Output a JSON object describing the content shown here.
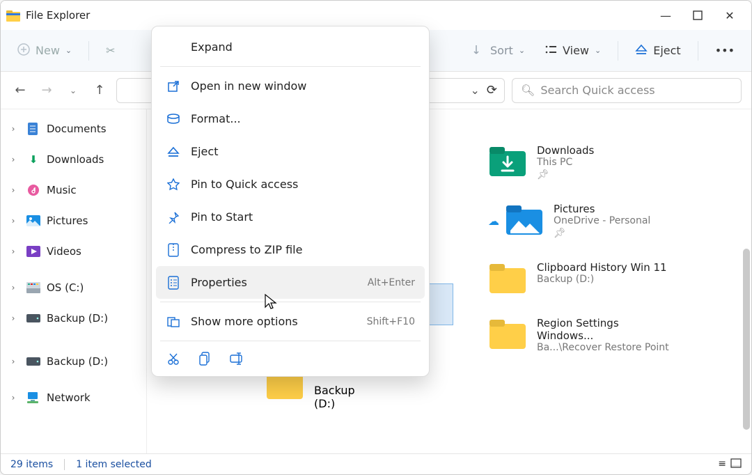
{
  "app": {
    "title": "File Explorer"
  },
  "win_controls": {
    "min": "—",
    "max": "▢",
    "close": "✕"
  },
  "toolbar": {
    "new_label": "New",
    "sort_label": "Sort",
    "view_label": "View",
    "eject_label": "Eject",
    "more_label": "•••"
  },
  "search": {
    "placeholder": "Search Quick access"
  },
  "nav": {
    "items": [
      {
        "label": "Documents",
        "icon": "documents"
      },
      {
        "label": "Downloads",
        "icon": "downloads-green"
      },
      {
        "label": "Music",
        "icon": "music"
      },
      {
        "label": "Pictures",
        "icon": "pictures"
      },
      {
        "label": "Videos",
        "icon": "videos"
      },
      {
        "label": "OS (C:)",
        "icon": "disk"
      },
      {
        "label": "Backup (D:)",
        "icon": "drive"
      },
      {
        "label": "Backup (D:)",
        "icon": "drive"
      },
      {
        "label": "Network",
        "icon": "network"
      }
    ]
  },
  "grid": {
    "items": [
      {
        "label": "Downloads",
        "sub": "This PC",
        "pinned": true,
        "icon": "downloads-teal",
        "cloud": false
      },
      {
        "label": "Pictures",
        "sub": "OneDrive - Personal",
        "pinned": true,
        "icon": "pictures-blue",
        "cloud": true
      },
      {
        "label": "Clipboard History Win 11",
        "sub": "Backup (D:)",
        "pinned": false,
        "icon": "folder",
        "cloud": false
      },
      {
        "label": "Region Settings Windows...",
        "sub": "Ba...\\Recover Restore Point",
        "pinned": false,
        "icon": "folder",
        "cloud": false
      },
      {
        "label": "",
        "sub": "Backup (D:)",
        "pinned": false,
        "icon": "folder",
        "cloud": false
      }
    ]
  },
  "context_menu": {
    "header": "Expand",
    "items": [
      {
        "label": "Open in new window",
        "icon": "open-window",
        "shortcut": ""
      },
      {
        "label": "Format...",
        "icon": "format",
        "shortcut": ""
      },
      {
        "label": "Eject",
        "icon": "eject",
        "shortcut": ""
      },
      {
        "label": "Pin to Quick access",
        "icon": "star",
        "shortcut": ""
      },
      {
        "label": "Pin to Start",
        "icon": "pin",
        "shortcut": ""
      },
      {
        "label": "Compress to ZIP file",
        "icon": "zip",
        "shortcut": ""
      },
      {
        "label": "Properties",
        "icon": "properties",
        "shortcut": "Alt+Enter",
        "hover": true
      },
      {
        "label": "Show more options",
        "icon": "more-options",
        "shortcut": "Shift+F10",
        "sep_before": true
      }
    ],
    "bottom_icons": [
      "cut",
      "copy",
      "rename"
    ]
  },
  "statusbar": {
    "count": "29 items",
    "selection": "1 item selected"
  }
}
